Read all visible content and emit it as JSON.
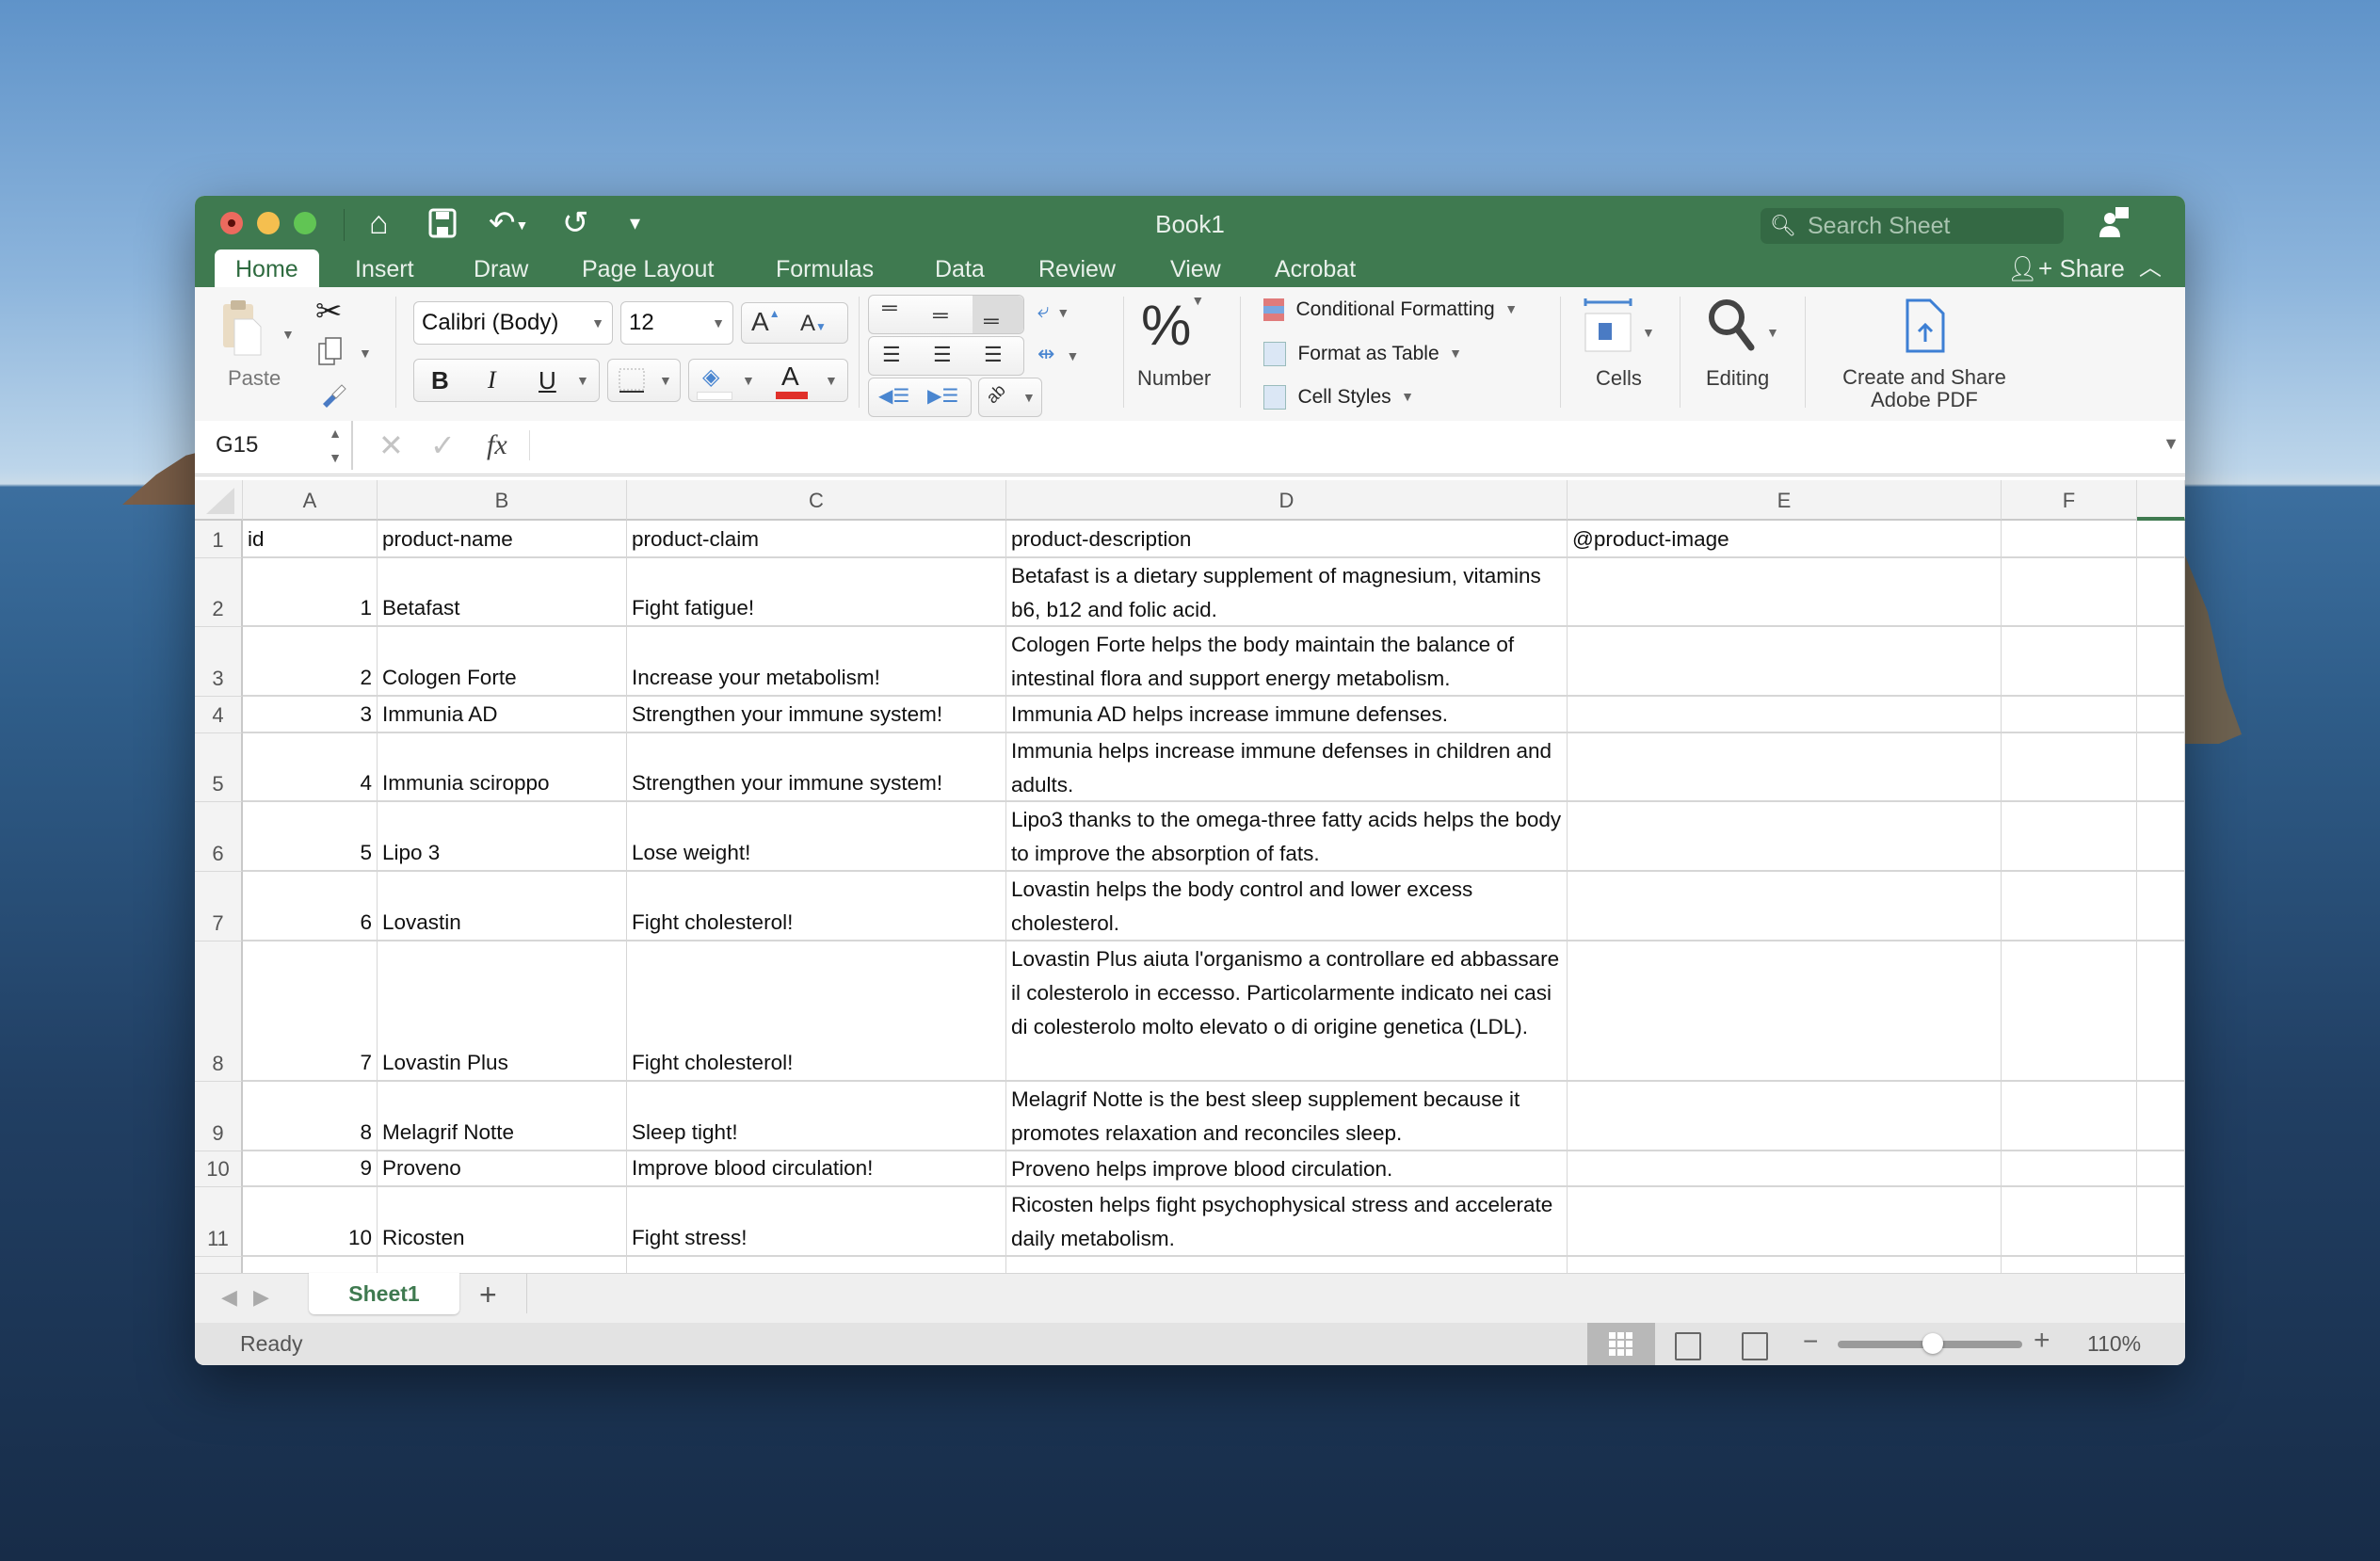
{
  "window": {
    "title": "Book1",
    "search_placeholder": "Search Sheet",
    "quick_access": [
      "home-icon",
      "save-icon",
      "undo-icon",
      "redo-icon",
      "customize-icon"
    ]
  },
  "tabs": [
    {
      "label": "Home",
      "active": true
    },
    {
      "label": "Insert"
    },
    {
      "label": "Draw"
    },
    {
      "label": "Page Layout"
    },
    {
      "label": "Formulas"
    },
    {
      "label": "Data"
    },
    {
      "label": "Review"
    },
    {
      "label": "View"
    },
    {
      "label": "Acrobat"
    }
  ],
  "share_label": "Share",
  "ribbon": {
    "paste_label": "Paste",
    "font_name": "Calibri (Body)",
    "font_size": "12",
    "bold": "B",
    "italic": "I",
    "underline": "U",
    "font_color_glyph": "A",
    "increase_font": "A",
    "decrease_font": "A",
    "number_symbol": "%",
    "number_label": "Number",
    "conditional_formatting": "Conditional Formatting",
    "format_as_table": "Format as Table",
    "cell_styles": "Cell Styles",
    "cells_label": "Cells",
    "editing_label": "Editing",
    "create_pdf_line1": "Create and Share",
    "create_pdf_line2": "Adobe PDF",
    "font_color": "#e0302a",
    "accent": "#3f7a50"
  },
  "formula_bar": {
    "name_box": "G15",
    "fx": "fx",
    "value": ""
  },
  "columns": [
    "A",
    "B",
    "C",
    "D",
    "E",
    "F"
  ],
  "header_row": [
    "id",
    "product-name",
    "product-claim",
    "product-description",
    "@product-image"
  ],
  "rows": [
    {
      "n": "2",
      "id": "1",
      "name": "Betafast",
      "claim": "Fight fatigue!",
      "desc": "Betafast is a dietary supplement of magnesium, vitamins b6, b12 and folic acid."
    },
    {
      "n": "3",
      "id": "2",
      "name": "Cologen Forte",
      "claim": "Increase your metabolism!",
      "desc": "Cologen Forte helps the body maintain the balance of intestinal flora and support energy metabolism."
    },
    {
      "n": "4",
      "id": "3",
      "name": "Immunia AD",
      "claim": "Strengthen your immune system!",
      "desc": "Immunia AD helps increase immune defenses."
    },
    {
      "n": "5",
      "id": "4",
      "name": "Immunia sciroppo",
      "claim": "Strengthen your immune system!",
      "desc": "Immunia helps increase immune defenses in children and adults."
    },
    {
      "n": "6",
      "id": "5",
      "name": "Lipo 3",
      "claim": "Lose weight!",
      "desc": "Lipo3 thanks to the omega-three fatty acids helps the body to improve the absorption of fats."
    },
    {
      "n": "7",
      "id": "6",
      "name": "Lovastin",
      "claim": "Fight cholesterol!",
      "desc": "Lovastin helps the body control and lower excess cholesterol."
    },
    {
      "n": "8",
      "id": "7",
      "name": "Lovastin Plus",
      "claim": "Fight cholesterol!",
      "desc": "Lovastin Plus aiuta l'organismo a controllare ed abbassare il colesterolo in eccesso. Particolarmente indicato nei casi di colesterolo molto elevato o di origine genetica (LDL)."
    },
    {
      "n": "9",
      "id": "8",
      "name": "Melagrif Notte",
      "claim": "Sleep tight!",
      "desc": "Melagrif Notte is the best sleep supplement because it promotes relaxation and reconciles sleep."
    },
    {
      "n": "10",
      "id": "9",
      "name": "Proveno",
      "claim": "Improve blood circulation!",
      "desc": "Proveno helps improve blood circulation."
    },
    {
      "n": "11",
      "id": "10",
      "name": "Ricosten",
      "claim": "Fight stress!",
      "desc": "Ricosten helps fight psychophysical stress and accelerate daily metabolism."
    }
  ],
  "sheet_tabs": [
    {
      "label": "Sheet1",
      "active": true
    }
  ],
  "status": {
    "text": "Ready",
    "zoom": "110%",
    "zoom_value": 110
  }
}
